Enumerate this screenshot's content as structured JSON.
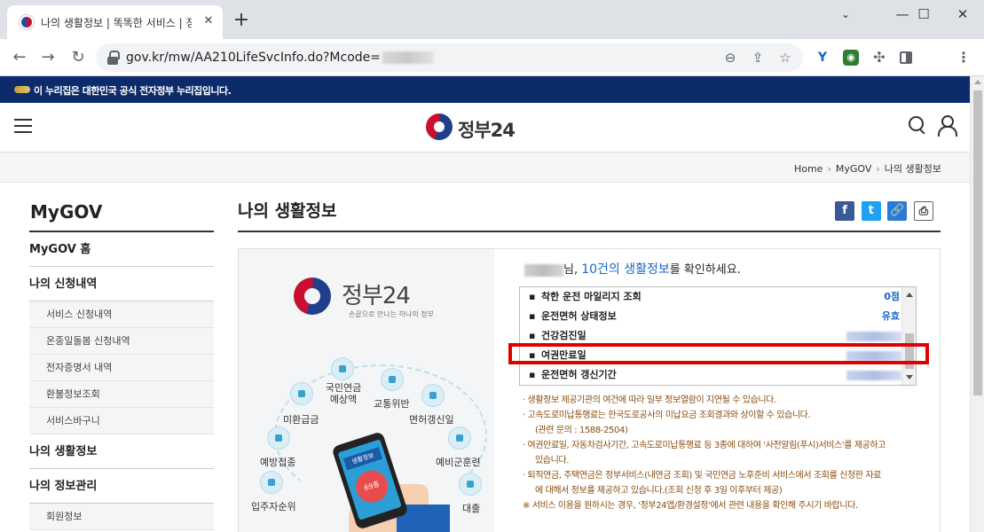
{
  "browser": {
    "tab_title": "나의 생활정보 | 똑똑한 서비스 | 정부24",
    "tab_close": "✕",
    "new_tab": "+",
    "url": "gov.kr/mw/AA210LifeSvcInfo.do?Mcode=",
    "window_controls": {
      "chevron": "⌄",
      "minimize": "—",
      "maximize": "☐",
      "close": "✕"
    },
    "nav": {
      "back": "←",
      "forward": "→",
      "reload": "↻"
    },
    "icons": [
      "zoom-icon",
      "share-icon",
      "star-icon",
      "extension-icon",
      "puzzle-icon",
      "sidepanel-icon",
      "menu-icon"
    ]
  },
  "site": {
    "gov_banner": "이 누리집은 대한민국 공식 전자정부 누리집입니다.",
    "logo_text": "정부24",
    "breadcrumb": [
      "Home",
      "MyGOV",
      "나의 생활정보"
    ],
    "breadcrumb_sep": "›"
  },
  "sidebar": {
    "title": "MyGOV",
    "items": [
      {
        "label": "MyGOV 홈",
        "type": "item"
      },
      {
        "label": "나의 신청내역",
        "type": "item"
      },
      {
        "label": "서비스 신청내역",
        "type": "sub"
      },
      {
        "label": "온종일돌봄 신청내역",
        "type": "sub"
      },
      {
        "label": "전자증명서 내역",
        "type": "sub"
      },
      {
        "label": "환불정보조회",
        "type": "sub"
      },
      {
        "label": "서비스바구니",
        "type": "sub"
      },
      {
        "label": "나의 생활정보",
        "type": "item"
      },
      {
        "label": "나의 정보관리",
        "type": "item"
      },
      {
        "label": "회원정보",
        "type": "sub"
      }
    ]
  },
  "main": {
    "title": "나의 생활정보",
    "share": {
      "facebook": "f",
      "twitter": "t",
      "link": "🔗",
      "print": "⎙"
    },
    "promo": {
      "name": "정부24",
      "slogan": "손끝으로 만나는 하나의 정부",
      "labels": [
        "미환급금",
        "국민연금\n예상액",
        "교통위반",
        "면허갱신일",
        "예방접종",
        "예비군훈련",
        "입주자순위",
        "대출"
      ],
      "phone_tag": "생활정보",
      "phone_count": "69종"
    },
    "greeting_mid": "님, ",
    "greeting_highlight": "10건의 생활정보",
    "greeting_end": "를 확인하세요.",
    "rows": [
      {
        "label": "착한 운전 마일리지 조회",
        "value": "0점"
      },
      {
        "label": "운전면허 상태정보",
        "value": "유효"
      },
      {
        "label": "건강검진일",
        "value": ""
      },
      {
        "label": "여권만료일",
        "value": ""
      },
      {
        "label": "운전면허 갱신기간",
        "value": ""
      }
    ],
    "bullet": "▪",
    "notes": [
      {
        "text": "· 생활정보 제공기관의 여건에 따라 일부 정보열람이 지연될 수 있습니다.",
        "indent": false
      },
      {
        "text": "· 고속도로미납통행료는 한국도로공사의 미납요금 조회결과와 상이할 수 있습니다.",
        "indent": false
      },
      {
        "text": "(관련 문의 : 1588-2504)",
        "indent": true
      },
      {
        "text": "· 여권만료일, 자동차검사기간, 고속도로미납통행료 등 3종에 대하여 '사전알림(푸시)서비스'를 제공하고",
        "indent": false
      },
      {
        "text": "있습니다.",
        "indent": true
      },
      {
        "text": "· 퇴직연금, 주택연금은 정부서비스(내연금 조회) 및 국민연금 노후준비 서비스에서 조회를 신청한 자료",
        "indent": false
      },
      {
        "text": "에 대해서 정보를 제공하고 있습니다.(조회 신청 후 3일 이후부터 제공)",
        "indent": true
      },
      {
        "text": "※ 서비스 이용을 원하시는 경우, '정부24앱/환경설정'에서 관련 내용을 확인해 주시기 바랍니다.",
        "indent": false
      }
    ]
  }
}
